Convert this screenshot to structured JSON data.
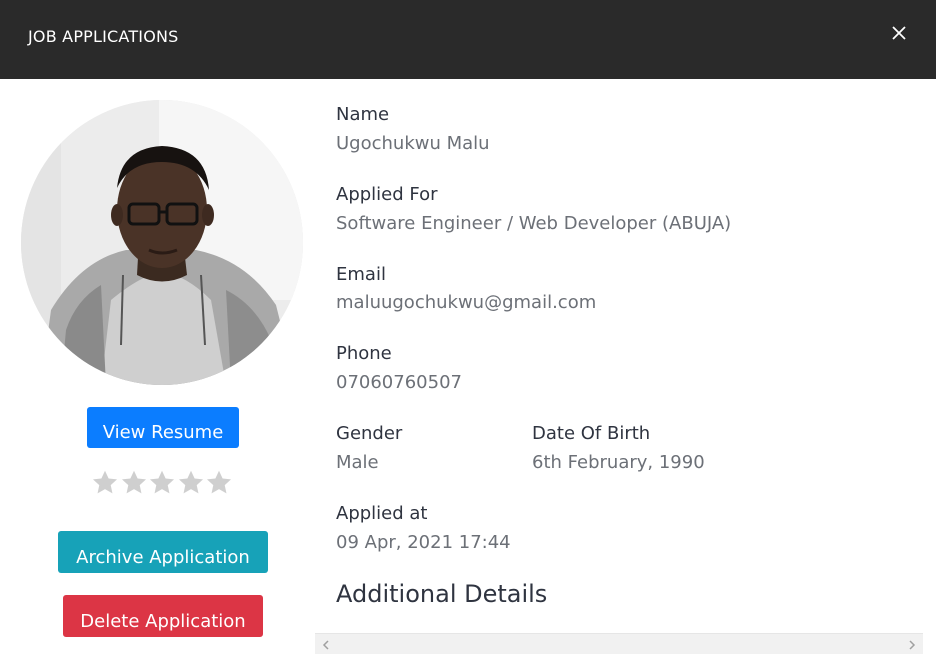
{
  "modal": {
    "title": "JOB APPLICATIONS",
    "close_icon": "close-icon"
  },
  "applicant": {
    "photo_icon": "applicant-photo",
    "view_resume_label": "View Resume",
    "rating": {
      "value": 0,
      "max": 5,
      "star_icon": "star-icon",
      "empty_color": "#cfcfcf"
    },
    "archive_label": "Archive Application",
    "delete_label": "Delete Application"
  },
  "details": {
    "name_label": "Name",
    "name_value": "Ugochukwu Malu",
    "applied_for_label": "Applied For",
    "applied_for_value": "Software Engineer / Web Developer (ABUJA)",
    "email_label": "Email",
    "email_value": "maluugochukwu@gmail.com",
    "phone_label": "Phone",
    "phone_value": "07060760507",
    "gender_label": "Gender",
    "gender_value": "Male",
    "dob_label": "Date Of Birth",
    "dob_value": "6th February, 1990",
    "applied_at_label": "Applied at",
    "applied_at_value": "09 Apr, 2021 17:44",
    "additional_title": "Additional Details"
  },
  "colors": {
    "header_bg": "#2a2a2a",
    "primary": "#0b7dff",
    "info": "#17a2b8",
    "danger": "#dc3545"
  }
}
